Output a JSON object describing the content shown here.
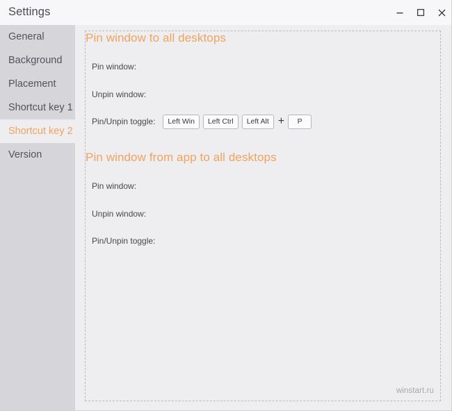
{
  "window": {
    "title": "Settings",
    "controls": [
      {
        "name": "minimize-button",
        "glyph": "minimize"
      },
      {
        "name": "maximize-button",
        "glyph": "maximize"
      },
      {
        "name": "close-button",
        "glyph": "close"
      }
    ]
  },
  "colors": {
    "accent_orange": "#f0a25f",
    "sidebar_bg": "#d6d6da",
    "content_bg": "#eeeef0",
    "titlebar_bg": "#f7f7f9",
    "label_text": "#48484d",
    "nav_text": "#53535a",
    "dashed_border": "#b9b9bd",
    "key_border": "#b7b7bb",
    "key_bg": "#fbfbfc",
    "watermark_text": "#a9a9ad"
  },
  "sidebar": {
    "items": [
      {
        "label": "General",
        "selected": false
      },
      {
        "label": "Background",
        "selected": false
      },
      {
        "label": "Placement",
        "selected": false
      },
      {
        "label": "Shortcut key 1",
        "selected": false
      },
      {
        "label": "Shortcut key 2",
        "selected": true
      },
      {
        "label": "Version",
        "selected": false
      }
    ]
  },
  "main": {
    "sections": [
      {
        "heading": "Pin window to all desktops",
        "rows": [
          {
            "label": "Pin window:",
            "keys": []
          },
          {
            "label": "Unpin window:",
            "keys": []
          },
          {
            "label": "Pin/Unpin toggle:",
            "keys": [
              "Left Win",
              "Left Ctrl",
              "Left Alt"
            ],
            "plus": "+",
            "final_key": "P"
          }
        ]
      },
      {
        "heading": "Pin window from app to all desktops",
        "rows": [
          {
            "label": "Pin window:",
            "keys": []
          },
          {
            "label": "Unpin window:",
            "keys": []
          },
          {
            "label": "Pin/Unpin toggle:",
            "keys": []
          }
        ]
      }
    ],
    "watermark": "winstart.ru"
  }
}
